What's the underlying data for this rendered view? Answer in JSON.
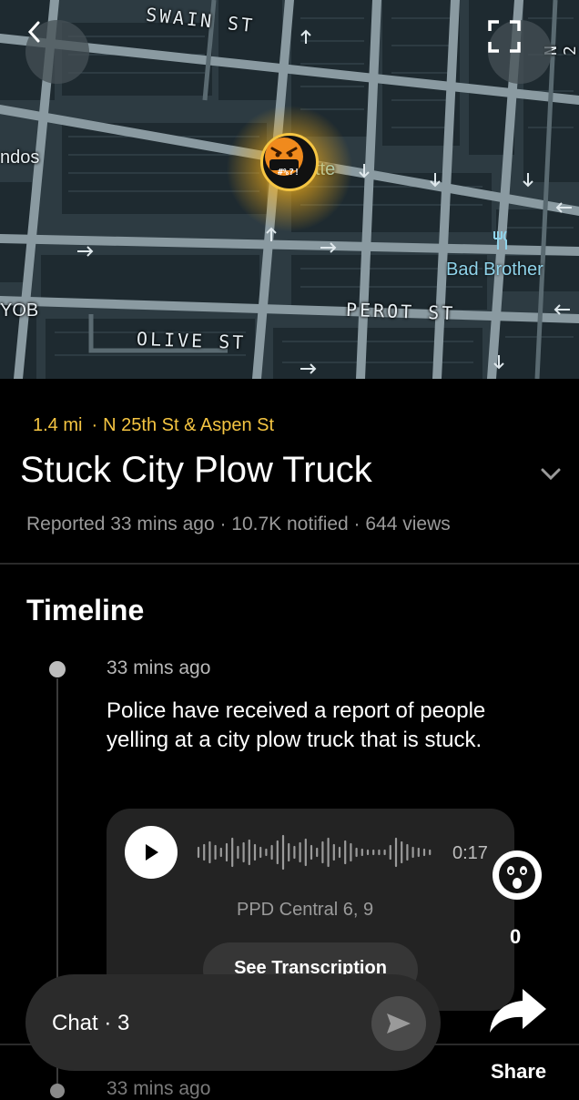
{
  "map": {
    "streets": {
      "swain": "SWAIN ST",
      "perot": "PEROT ST",
      "olive": "OLIVE ST",
      "n2": "N 2",
      "partial_left_top": "ndos",
      "partial_left_mid": "YOB",
      "partial_center": "tte"
    },
    "poi": {
      "name": "Bad Brother",
      "icon": "restaurant-icon"
    },
    "marker": {
      "label": "#%?!",
      "icon": "angry-face-icon"
    },
    "back_icon": "chevron-left-icon",
    "fullscreen_icon": "fullscreen-icon"
  },
  "incident": {
    "distance": "1.4 mi",
    "location": "N 25th St & Aspen St",
    "title": "Stuck City Plow Truck",
    "meta": "Reported 33 mins ago · 10.7K notified · 644 views"
  },
  "timeline": {
    "heading": "Timeline",
    "entries": [
      {
        "time": "33 mins ago",
        "text": "Police have received a report of people yelling at a city plow truck that is stuck.",
        "audio": {
          "duration": "0:17",
          "source": "PPD Central 6, 9",
          "transcription_label": "See Transcription"
        }
      },
      {
        "time": "33 mins ago"
      }
    ]
  },
  "actions": {
    "reaction_count": "0",
    "share_label": "Share"
  },
  "chat": {
    "label": "Chat · 3"
  },
  "colors": {
    "accent": "#f5c542",
    "map_bg": "#2d3b42",
    "card": "#232323"
  }
}
